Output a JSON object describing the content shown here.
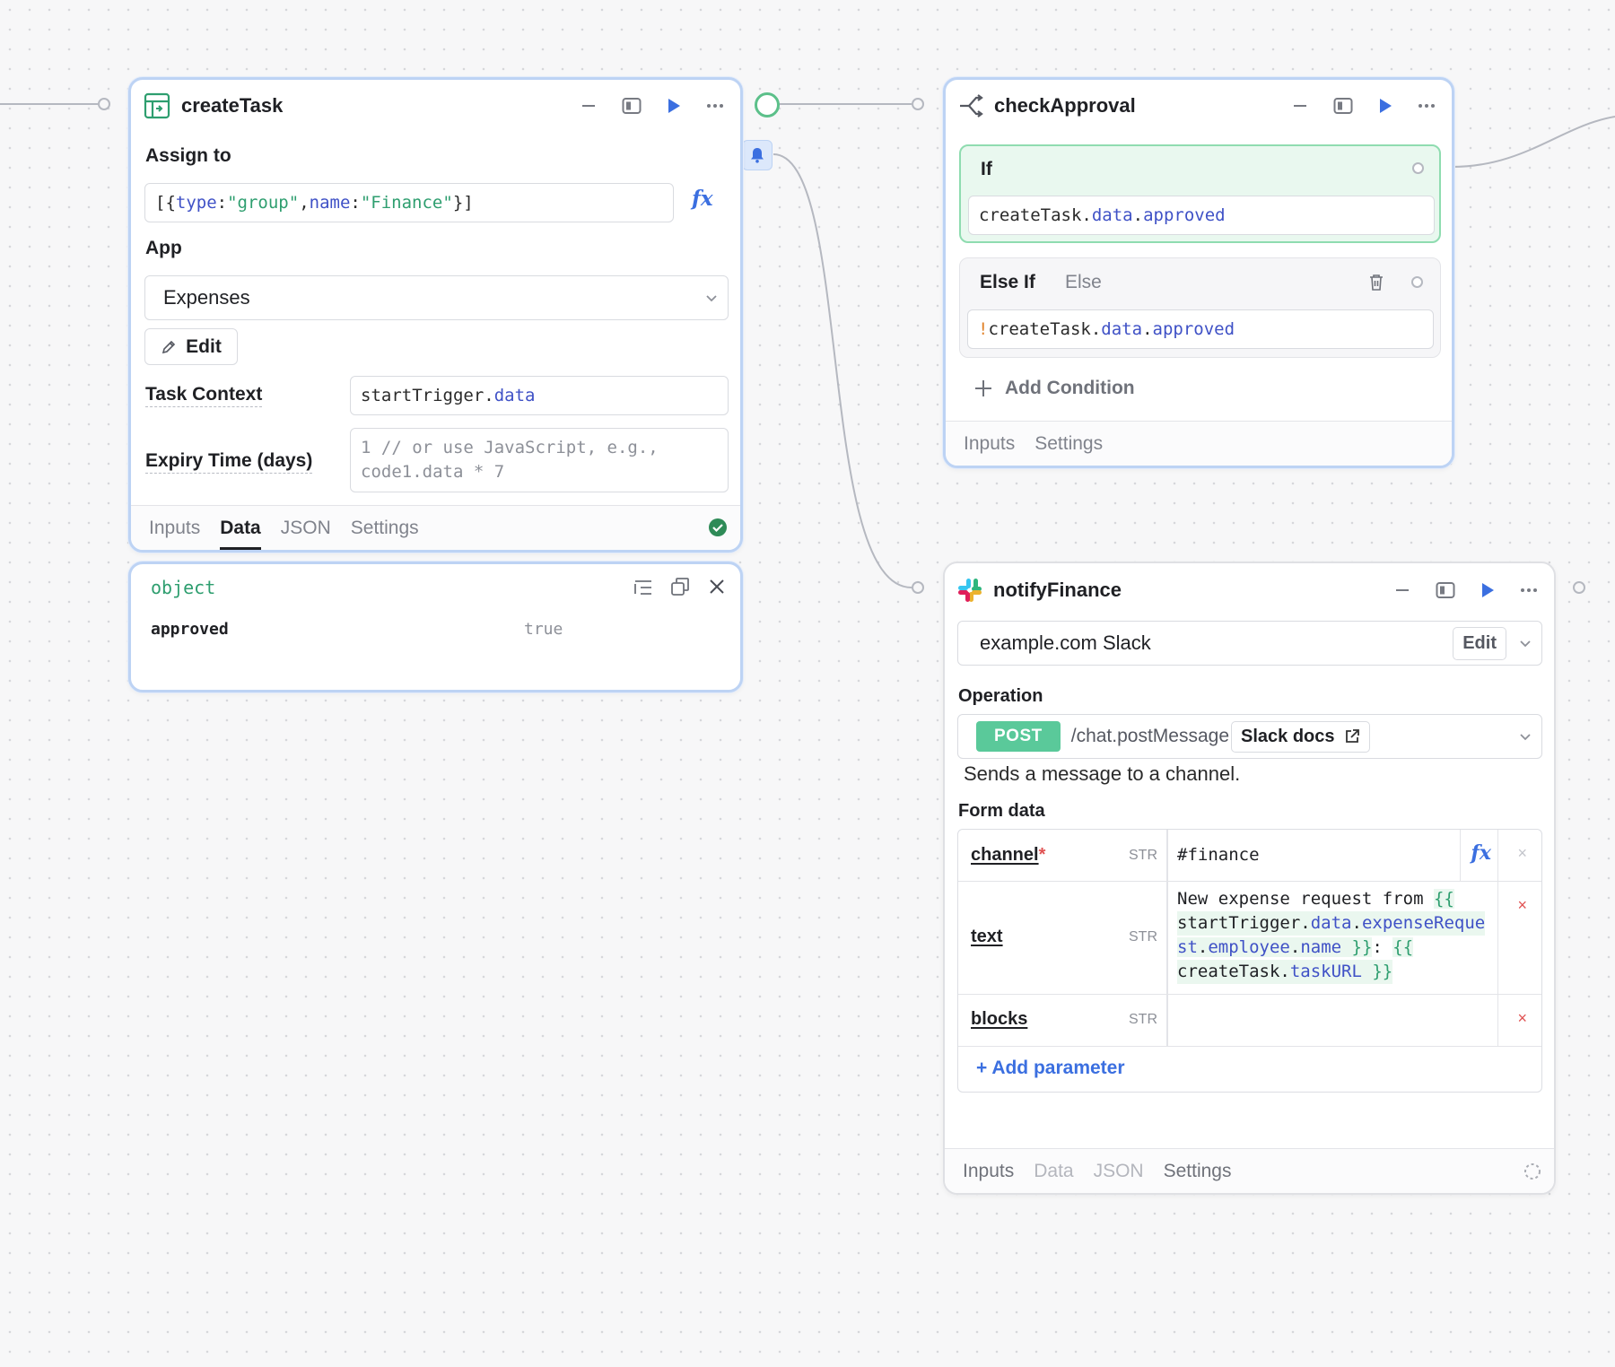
{
  "createTask": {
    "title": "createTask",
    "assign_label": "Assign to",
    "assign_value": {
      "open": "[{ ",
      "k1": "type",
      "c1": ": ",
      "v1": "\"group\"",
      "sep": ", ",
      "k2": "name",
      "c2": ": ",
      "v2": "\"Finance\"",
      "close": " }]"
    },
    "fx_label": "fx",
    "app_label": "App",
    "app_value": "Expenses",
    "edit_label": "Edit",
    "task_context_label": "Task Context",
    "task_context_obj": "startTrigger",
    "task_context_dot": ".",
    "task_context_prop": "data",
    "expiry_label": "Expiry Time (days)",
    "expiry_placeholder_1": "1 // or use JavaScript, e.g.,",
    "expiry_placeholder_2": "code1.data * 7",
    "tabs": [
      "Inputs",
      "Data",
      "JSON",
      "Settings"
    ],
    "active_tab": "Data",
    "status": "success"
  },
  "dataPanel": {
    "type_label": "object",
    "key": "approved",
    "value": "true"
  },
  "checkApproval": {
    "title": "checkApproval",
    "if_label": "If",
    "if_expr": {
      "obj": "createTask",
      "d1": ".",
      "p1": "data",
      "d2": ".",
      "p2": "approved"
    },
    "elseif_label": "Else If",
    "else_label": "Else",
    "elseif_expr": {
      "neg": "!",
      "obj": "createTask",
      "d1": ".",
      "p1": "data",
      "d2": ".",
      "p2": "approved"
    },
    "add_condition": "Add Condition",
    "tabs": [
      "Inputs",
      "Settings"
    ]
  },
  "notifyFinance": {
    "title": "notifyFinance",
    "resource": "example.com Slack",
    "resource_edit": "Edit",
    "operation_label": "Operation",
    "method": "POST",
    "endpoint": "/chat.postMessage",
    "docs_label": "Slack docs",
    "description": "Sends a message to a channel.",
    "form_label": "Form data",
    "params": [
      {
        "name": "channel",
        "required": "*",
        "type": "STR",
        "value": "#finance"
      },
      {
        "name": "text",
        "type": "STR",
        "l1_text": "New expense request from ",
        "l1_brace": "{{",
        "l2_obj": "startTrigger",
        "l2_dot": ".",
        "l2_p1": "data",
        "l2_dot2": ".",
        "l2_p2": "expenseReque",
        "l3_p2b": "st",
        "l3_dot": ".",
        "l3_p3": "employee",
        "l3_dot2": ".",
        "l3_p4": "name",
        "l3_close": " }}",
        "l3_colon": ": ",
        "l3_open": "{{",
        "l4_obj": "createTask",
        "l4_dot": ".",
        "l4_p": "taskURL",
        "l4_close": " }}"
      },
      {
        "name": "blocks",
        "type": "STR",
        "value": ""
      }
    ],
    "remove_label": "×",
    "add_param": "+ Add parameter",
    "tabs": [
      "Inputs",
      "Data",
      "JSON",
      "Settings"
    ]
  },
  "colors": {
    "accent_blue": "#3b6fe0",
    "success_green": "#2e8b57",
    "if_green": "#e9f8ef",
    "post_green": "#5ac99a"
  }
}
